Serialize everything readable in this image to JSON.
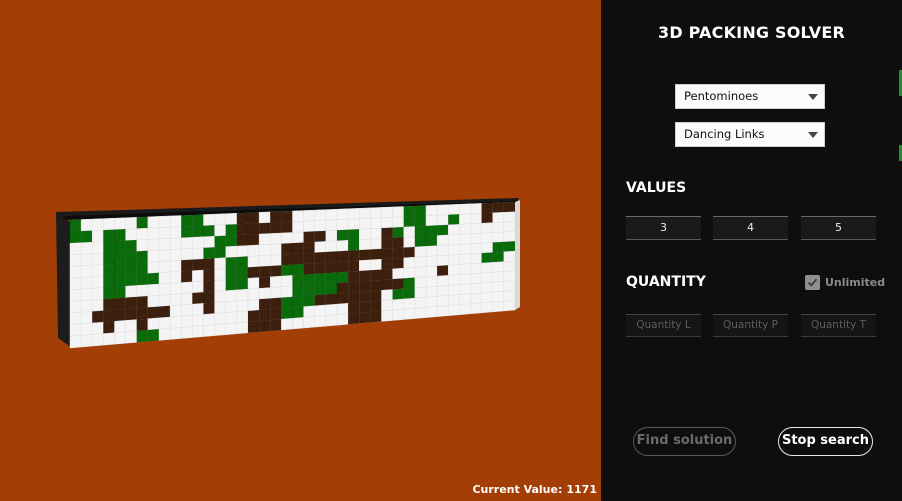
{
  "viewport": {
    "background": "#a33e06",
    "status_label": "Current Value:",
    "status_value": "1171"
  },
  "panel": {
    "title": "3D PACKING SOLVER",
    "shape_dropdown": {
      "selected": "Pentominoes"
    },
    "algorithm_dropdown": {
      "selected": "Dancing Links"
    },
    "values": {
      "title": "VALUES",
      "fields": [
        "3",
        "4",
        "5"
      ]
    },
    "quantity": {
      "title": "QUANTITY",
      "unlimited_label": "Unlimited",
      "unlimited_checked": true,
      "placeholders": [
        "Quantity L",
        "Quantity P",
        "Quantity T"
      ]
    },
    "buttons": {
      "find": "Find solution",
      "stop": "Stop search"
    }
  },
  "colors": {
    "piece_white": "#f4f4f4",
    "piece_green": "#0a6b0a",
    "piece_brown": "#3d1f0d",
    "panel_bg": "#0e0e0e"
  }
}
